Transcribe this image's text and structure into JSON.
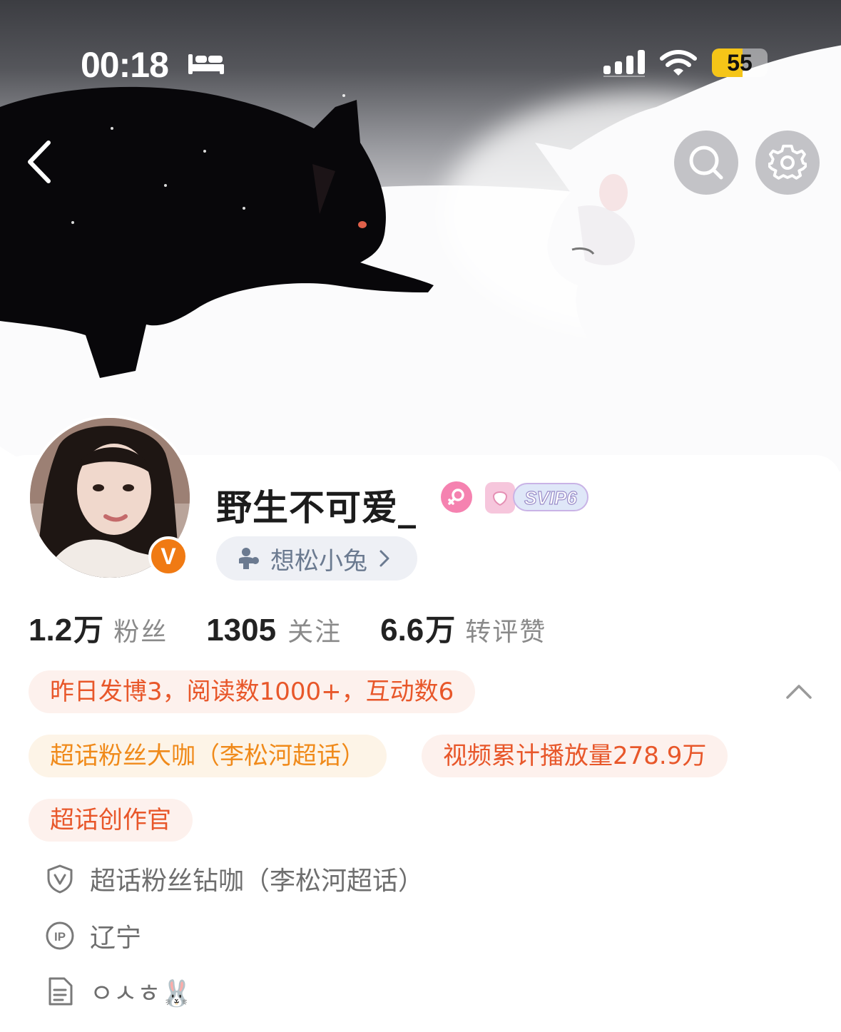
{
  "status_bar": {
    "time": "00:18",
    "battery_percent": "55",
    "battery_level": 0.55,
    "icons": [
      "sleep-focus-icon",
      "cellular-signal-icon",
      "wifi-icon",
      "battery-icon"
    ]
  },
  "nav": {
    "icons": [
      "back-chevron-icon",
      "search-icon",
      "gear-icon"
    ]
  },
  "profile": {
    "username": "野生不可爱_",
    "verified_badge": "V",
    "gender_icon": "female-icon",
    "vip_badge": "SVIP6",
    "group_label": "想松小兔",
    "colors": {
      "verified": "#f07a13",
      "gender": "#f582b0",
      "tag_red": "#e8572a",
      "tag_gold": "#f08a1a"
    }
  },
  "stats": [
    {
      "number": "1.2",
      "unit": "万",
      "label": "粉丝"
    },
    {
      "number": "1305",
      "unit": "",
      "label": "关注"
    },
    {
      "number": "6.6",
      "unit": "万",
      "label": "转评赞"
    }
  ],
  "tags": {
    "summary": "昨日发博3，阅读数1000+，互动数6",
    "superfan": "超话粉丝大咖（李松河超话）",
    "video_plays": "视频累计播放量278.9万",
    "creator": "超话创作官"
  },
  "info": {
    "badge_text": "超话粉丝钻咖（李松河超话）",
    "ip_location": "辽宁",
    "bio": "ㅇㅅㅎ🐰"
  }
}
